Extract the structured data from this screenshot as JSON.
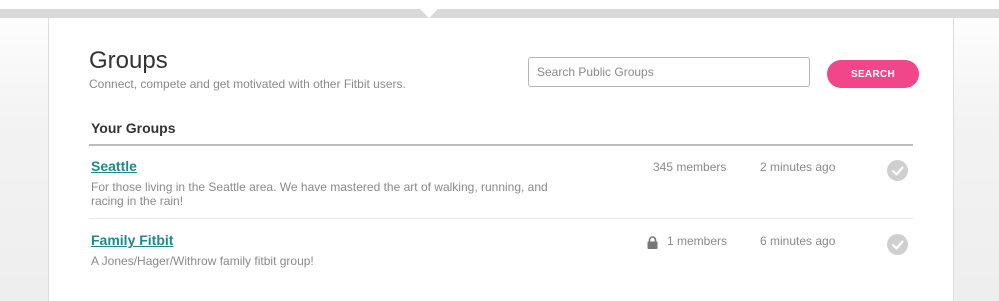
{
  "header": {
    "title": "Groups",
    "subtitle": "Connect, compete and get motivated with other Fitbit users."
  },
  "search": {
    "placeholder": "Search Public Groups",
    "value": "",
    "button_label": "SEARCH"
  },
  "your_groups": {
    "heading": "Your Groups",
    "groups": [
      {
        "name": "Seattle",
        "description": "For those living in the Seattle area. We have mastered the art of walking, running, and racing in the rain!",
        "members": "345 members",
        "updated": "2 minutes ago",
        "private": false
      },
      {
        "name": "Family Fitbit",
        "description": "A Jones/Hager/Withrow family fitbit group!",
        "members": "1 members",
        "updated": "6 minutes ago",
        "private": true
      }
    ]
  },
  "colors": {
    "accent": "#f2468a",
    "link": "#1f8a89",
    "muted_text": "#8a8a8a"
  },
  "icons": {
    "lock": "lock-icon",
    "joined": "check-circle-icon"
  }
}
